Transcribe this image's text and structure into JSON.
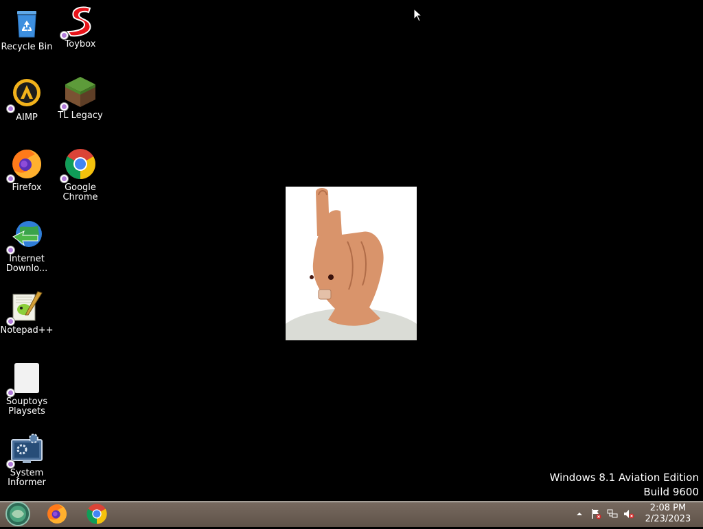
{
  "desktop_icons": [
    {
      "label": "Recycle Bin",
      "icon": "recycle-bin-icon"
    },
    {
      "label": "Toybox",
      "icon": "toybox-icon"
    },
    {
      "label": "AIMP",
      "icon": "aimp-icon"
    },
    {
      "label": "TL Legacy",
      "icon": "minecraft-grass-icon"
    },
    {
      "label": "Firefox",
      "icon": "firefox-icon"
    },
    {
      "label": "Google Chrome",
      "icon": "chrome-icon"
    },
    {
      "label": "Internet Downlo...",
      "icon": "internet-download-manager-icon"
    },
    {
      "label": "Notepad++",
      "icon": "notepadpp-icon"
    },
    {
      "label": "Souptoys Playsets",
      "icon": "blank-file-icon"
    },
    {
      "label": "System Informer",
      "icon": "system-informer-icon"
    }
  ],
  "watermark": {
    "line1": "Windows 8.1 Aviation Edition",
    "line2": "Build 9600"
  },
  "taskbar": {
    "pinned": [
      {
        "name": "Firefox",
        "icon": "firefox-icon"
      },
      {
        "name": "Google Chrome",
        "icon": "chrome-icon"
      }
    ],
    "tray_icons": [
      "show-hidden-icons-arrow",
      "action-center-flag-icon",
      "network-icon",
      "volume-muted-icon"
    ],
    "clock": {
      "time": "2:08 PM",
      "date": "2/23/2023"
    }
  },
  "colors": {
    "desktop_background": "#000000",
    "taskbar": "#6b5e54",
    "text": "#ffffff"
  }
}
